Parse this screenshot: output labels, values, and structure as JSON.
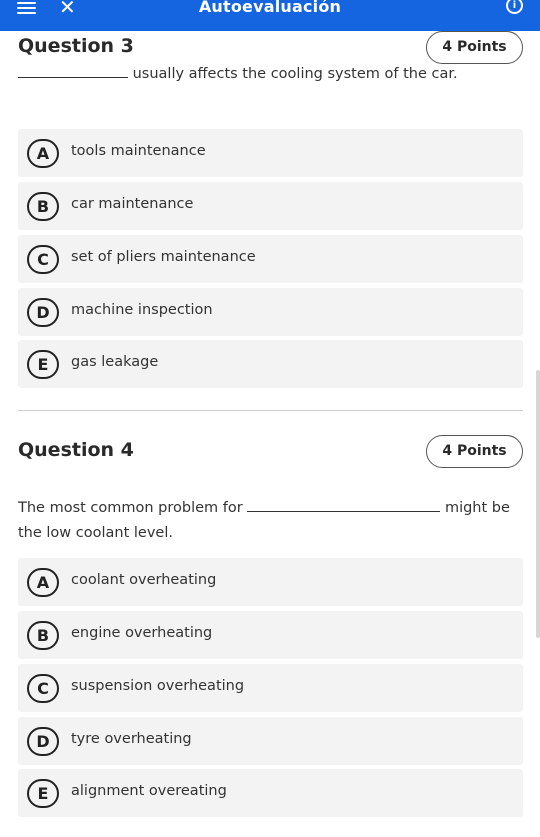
{
  "header": {
    "title": "Autoevaluación",
    "menu_icon": "hamburger-menu-icon",
    "close_icon": "close-icon",
    "info_icon": "info-icon",
    "accent_color": "#1565e0"
  },
  "questions": [
    {
      "title": "Question 3",
      "points": "4 Points",
      "text_after_blank": "usually affects the cooling system of the car.",
      "options": [
        {
          "letter": "A",
          "text": "tools maintenance"
        },
        {
          "letter": "B",
          "text": "car maintenance"
        },
        {
          "letter": "C",
          "text": "set of pliers maintenance"
        },
        {
          "letter": "D",
          "text": "machine inspection"
        },
        {
          "letter": "E",
          "text": "gas leakage"
        }
      ]
    },
    {
      "title": "Question 4",
      "points": "4 Points",
      "text_before_blank": "The most common problem for",
      "text_after_blank": "might be the low coolant level.",
      "options": [
        {
          "letter": "A",
          "text": "coolant overheating"
        },
        {
          "letter": "B",
          "text": "engine overheating"
        },
        {
          "letter": "C",
          "text": "suspension overheating"
        },
        {
          "letter": "D",
          "text": "tyre overheating"
        },
        {
          "letter": "E",
          "text": "alignment overeating"
        }
      ]
    }
  ]
}
